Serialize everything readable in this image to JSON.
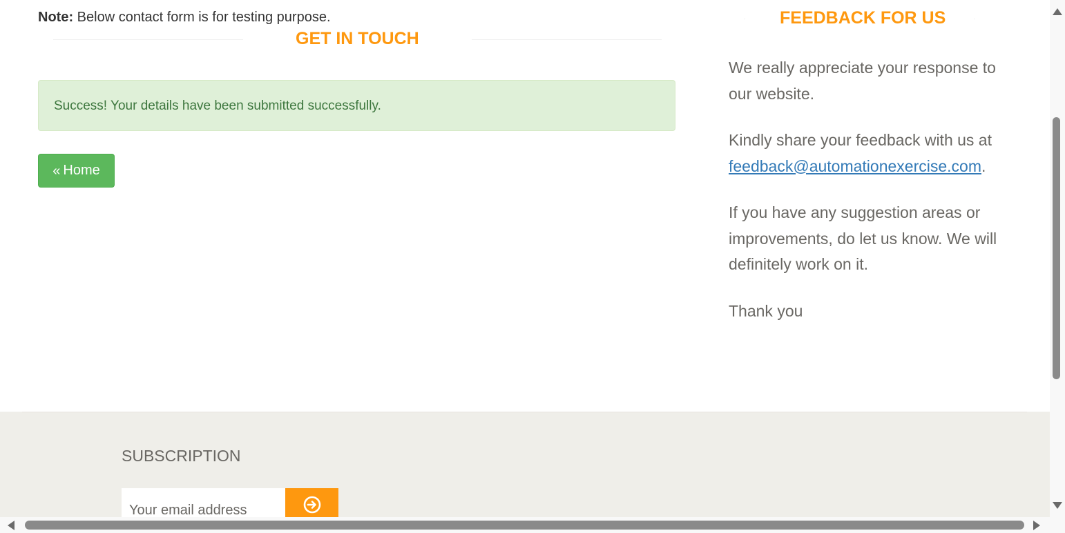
{
  "contact": {
    "note_label": "Note:",
    "note_text": " Below contact form is for testing purpose.",
    "heading": "GET IN TOUCH",
    "success_message": "Success! Your details have been submitted successfully.",
    "home_button_label": "Home",
    "home_icon": "double-angle-left-icon"
  },
  "feedback": {
    "heading": "FEEDBACK FOR US",
    "paragraph1": "We really appreciate your response to our website.",
    "paragraph2_prefix": "Kindly share your feedback with us at ",
    "email": "feedback@automationexercise.com",
    "paragraph2_suffix": ".",
    "paragraph3": "If you have any suggestion areas or improvements, do let us know. We will definitely work on it.",
    "paragraph4": "Thank you"
  },
  "footer": {
    "subscription_title": "SUBSCRIPTION",
    "email_placeholder": "Your email address",
    "subscribe_icon": "circle-arrow-right-icon"
  },
  "colors": {
    "accent": "#FE980F",
    "success_bg": "#dff0d8",
    "success_text": "#3c763d",
    "home_button": "#5cb85c",
    "link": "#337ab7",
    "footer_bg": "#efeee9"
  }
}
